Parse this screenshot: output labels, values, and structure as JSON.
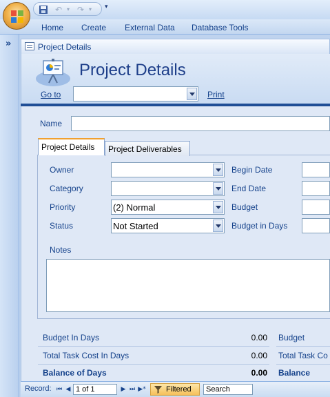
{
  "quick_access": {
    "save_icon": "save-icon",
    "undo_icon": "undo-icon",
    "redo_icon": "redo-icon",
    "customize_icon": "customize-qat-icon"
  },
  "ribbon": {
    "tabs": [
      "Home",
      "Create",
      "External Data",
      "Database Tools"
    ]
  },
  "nav_pane": {
    "toggle": "»"
  },
  "document_tab": {
    "label": "Project Details"
  },
  "form": {
    "title": "Project Details",
    "goto_label": "Go to",
    "goto_value": "",
    "print_label": "Print",
    "name_label": "Name",
    "name_value": ""
  },
  "tabs": {
    "items": [
      {
        "label": "Project Details",
        "active": true
      },
      {
        "label": "Project Deliverables",
        "active": false
      }
    ]
  },
  "fields": {
    "owner": {
      "label": "Owner",
      "value": ""
    },
    "category": {
      "label": "Category",
      "value": ""
    },
    "priority": {
      "label": "Priority",
      "value": "(2) Normal"
    },
    "status": {
      "label": "Status",
      "value": "Not Started"
    },
    "begin_date": {
      "label": "Begin Date",
      "value": ""
    },
    "end_date": {
      "label": "End Date",
      "value": ""
    },
    "budget": {
      "label": "Budget",
      "value": ""
    },
    "budget_in_days": {
      "label": "Budget in Days",
      "value": ""
    },
    "notes": {
      "label": "Notes",
      "value": ""
    }
  },
  "summary": {
    "left": [
      {
        "label": "Budget In Days",
        "value": "0.00",
        "bold": false
      },
      {
        "label": "Total Task Cost In Days",
        "value": "0.00",
        "bold": false
      },
      {
        "label": "Balance of Days",
        "value": "0.00",
        "bold": true
      }
    ],
    "right": [
      {
        "label": "Budget",
        "bold": false
      },
      {
        "label": "Total Task Co",
        "bold": false
      },
      {
        "label": "Balance",
        "bold": true
      }
    ]
  },
  "record_nav": {
    "record_label": "Record:",
    "position": "1 of 1",
    "filter_label": "Filtered",
    "search_placeholder": "Search"
  },
  "colors": {
    "accent": "#15428b",
    "header_rule": "#1f4e96",
    "tab_highlight": "#f0a030"
  }
}
